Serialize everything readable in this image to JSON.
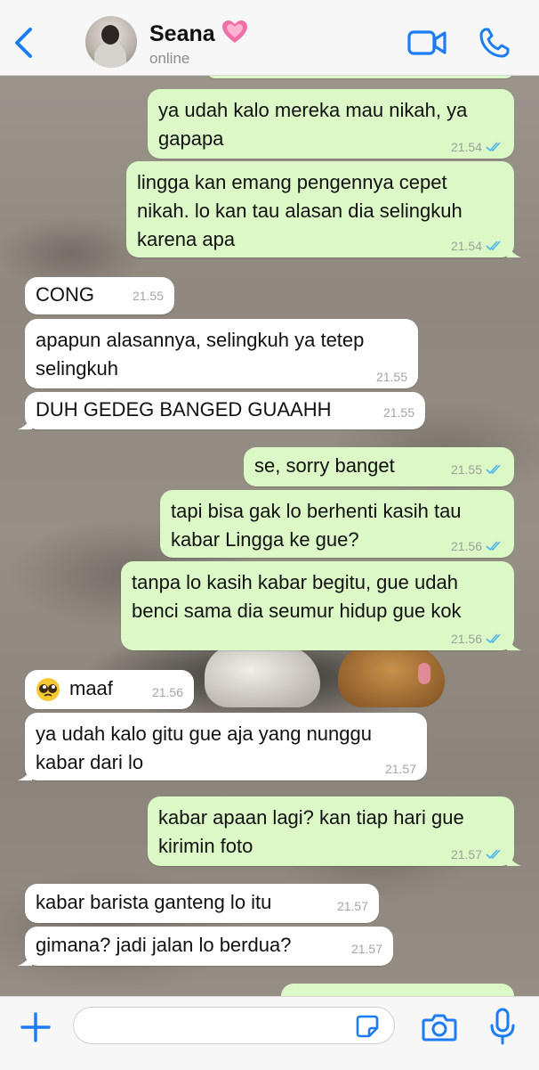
{
  "header": {
    "name": "Seana",
    "name_emoji": "growing-heart",
    "status": "online"
  },
  "messages": [
    {
      "side": "out",
      "text": "ya udah kalo mereka mau nikah, ya\ngapapa",
      "time": "21.54",
      "read": true
    },
    {
      "side": "out",
      "text": "lingga kan emang pengennya cepet\nnikah. lo kan tau alasan dia selingkuh\nkarena apa",
      "time": "21.54",
      "read": true
    },
    {
      "side": "in",
      "text": "CONG",
      "time": "21.55"
    },
    {
      "side": "in",
      "text": "apapun alasannya, selingkuh ya tetep\nselingkuh",
      "time": "21.55"
    },
    {
      "side": "in",
      "text": "DUH GEDEG BANGED GUAAHH",
      "time": "21.55"
    },
    {
      "side": "out",
      "text": "se, sorry banget",
      "time": "21.55",
      "read": true
    },
    {
      "side": "out",
      "text": "tapi bisa gak lo berhenti kasih tau\nkabar Lingga ke gue?",
      "time": "21.56",
      "read": true
    },
    {
      "side": "out",
      "text": "tanpa lo kasih kabar begitu, gue udah\nbenci sama dia seumur hidup gue kok",
      "time": "21.56",
      "read": true
    },
    {
      "side": "in",
      "text": "maaf",
      "emoji": "pleading-face",
      "time": "21.56"
    },
    {
      "side": "in",
      "text": "ya udah kalo gitu gue aja yang nunggu\nkabar dari lo",
      "time": "21.57"
    },
    {
      "side": "out",
      "text": "kabar apaan lagi? kan tiap hari gue\nkirimin foto",
      "time": "21.57",
      "read": true
    },
    {
      "side": "in",
      "text": "kabar barista ganteng lo itu",
      "time": "21.57"
    },
    {
      "side": "in",
      "text": "gimana? jadi jalan lo berdua?",
      "time": "21.57"
    }
  ],
  "input": {
    "placeholder": ""
  },
  "colors": {
    "accent": "#1b7cf5",
    "outgoing_bubble": "#dcf8c6",
    "incoming_bubble": "#ffffff",
    "read_ticks": "#4fb6ec"
  }
}
